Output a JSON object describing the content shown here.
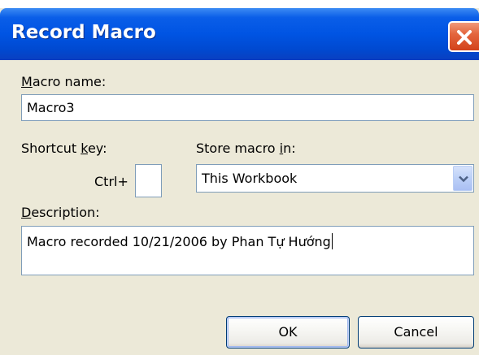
{
  "window": {
    "title": "Record Macro"
  },
  "macro_name": {
    "label_prefix": "",
    "label_access_key": "M",
    "label_rest": "acro name:",
    "value": "Macro3"
  },
  "shortcut": {
    "label_prefix": "Shortcut ",
    "label_access_key": "k",
    "label_rest": "ey:",
    "ctrl_label": "Ctrl+",
    "value": ""
  },
  "store_in": {
    "label_prefix": "Store macro ",
    "label_access_key": "i",
    "label_rest": "n:",
    "selected": "This Workbook"
  },
  "description": {
    "label_prefix": "",
    "label_access_key": "D",
    "label_rest": "escription:",
    "value": "Macro recorded 10/21/2006 by Phan Tự Hướng"
  },
  "buttons": {
    "ok": "OK",
    "cancel": "Cancel"
  },
  "icons": {
    "close": "close-icon",
    "dropdown": "chevron-down-icon"
  },
  "colors": {
    "titlebar": "#0054e3",
    "close_button": "#e4663e",
    "dialog_background": "#ece9d8",
    "field_border": "#7f9db9"
  }
}
